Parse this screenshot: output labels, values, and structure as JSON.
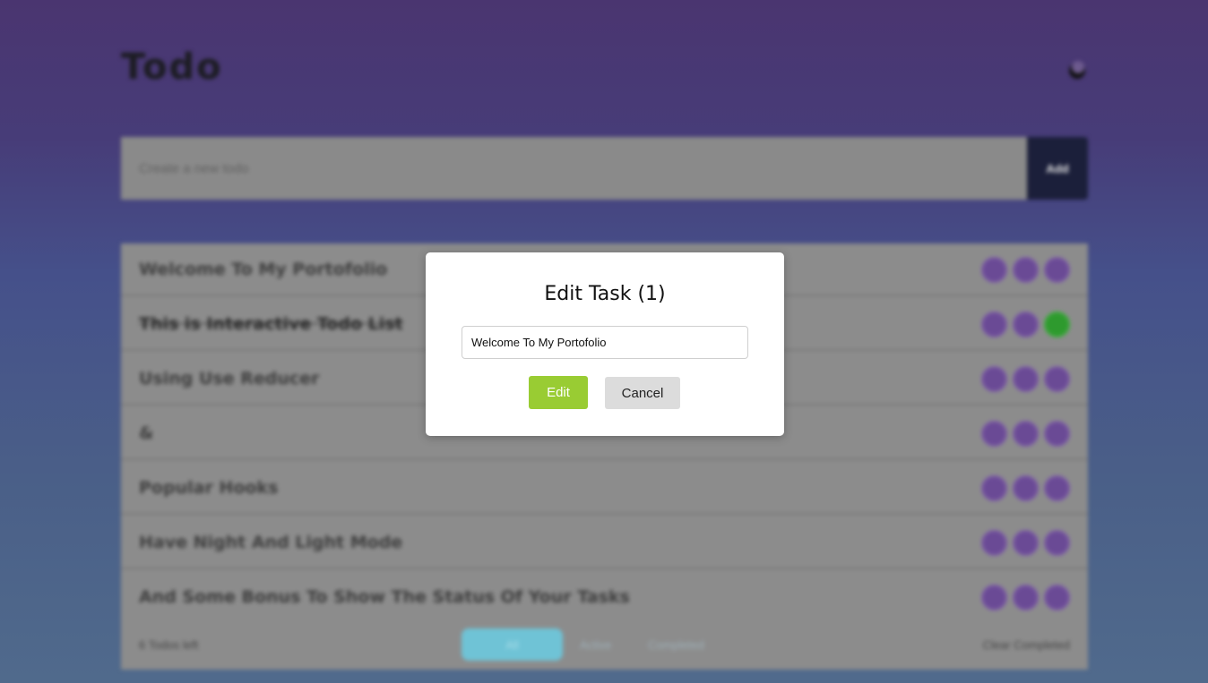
{
  "app": {
    "title": "Todo",
    "theme_toggle_icon": "moon-icon"
  },
  "new_todo": {
    "placeholder": "Create a new todo",
    "add_label": "Add"
  },
  "todos": [
    {
      "text": "Welcome To My Portofolio",
      "completed": false
    },
    {
      "text": "This is Interactive Todo List",
      "completed": true
    },
    {
      "text": "Using Use Reducer",
      "completed": false
    },
    {
      "text": "&",
      "completed": false
    },
    {
      "text": "Popular Hooks",
      "completed": false
    },
    {
      "text": "Have Night And Light Mode",
      "completed": false
    },
    {
      "text": "And Some Bonus To Show The Status Of Your Tasks",
      "completed": false
    }
  ],
  "footer": {
    "count_text": "6 Todos left",
    "filters": [
      "All",
      "Active",
      "Completed"
    ],
    "active_filter": "All",
    "clear_label": "Clear Completed"
  },
  "modal": {
    "title": "Edit Task (1)",
    "input_value": "Welcome To My Portofolio",
    "edit_label": "Edit",
    "cancel_label": "Cancel"
  },
  "colors": {
    "edit_button": "#99cc33",
    "cancel_button": "#dcdcdc",
    "action_circle": "#6a4a95",
    "completed_circle": "#2e9a2e",
    "add_button": "#1b1f3a"
  }
}
